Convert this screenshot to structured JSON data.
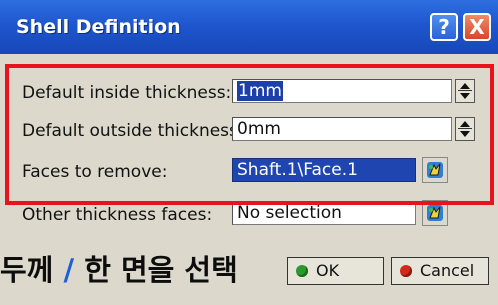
{
  "window": {
    "title": "Shell Definition",
    "help_label": "?",
    "close_label": "X"
  },
  "form": {
    "inside": {
      "label": "Default inside thickness:",
      "value": "1mm"
    },
    "outside": {
      "label": "Default outside thickness:",
      "value": "0mm"
    },
    "faces_remove": {
      "label": "Faces to remove:",
      "value": "Shaft.1\\Face.1"
    },
    "other_faces": {
      "label": "Other thickness faces:",
      "value": "No selection"
    }
  },
  "caption": {
    "left_text": "두께",
    "slash": "/",
    "right_text": "한 면을 선택"
  },
  "buttons": {
    "ok_label": "OK",
    "cancel_label": "Cancel"
  },
  "colors": {
    "title_bar": "#1f56cf",
    "highlight_box": "#e8131b",
    "selection": "#1f46b0",
    "ok_dot": "#2a9a2a",
    "cancel_dot": "#d12a1a"
  }
}
